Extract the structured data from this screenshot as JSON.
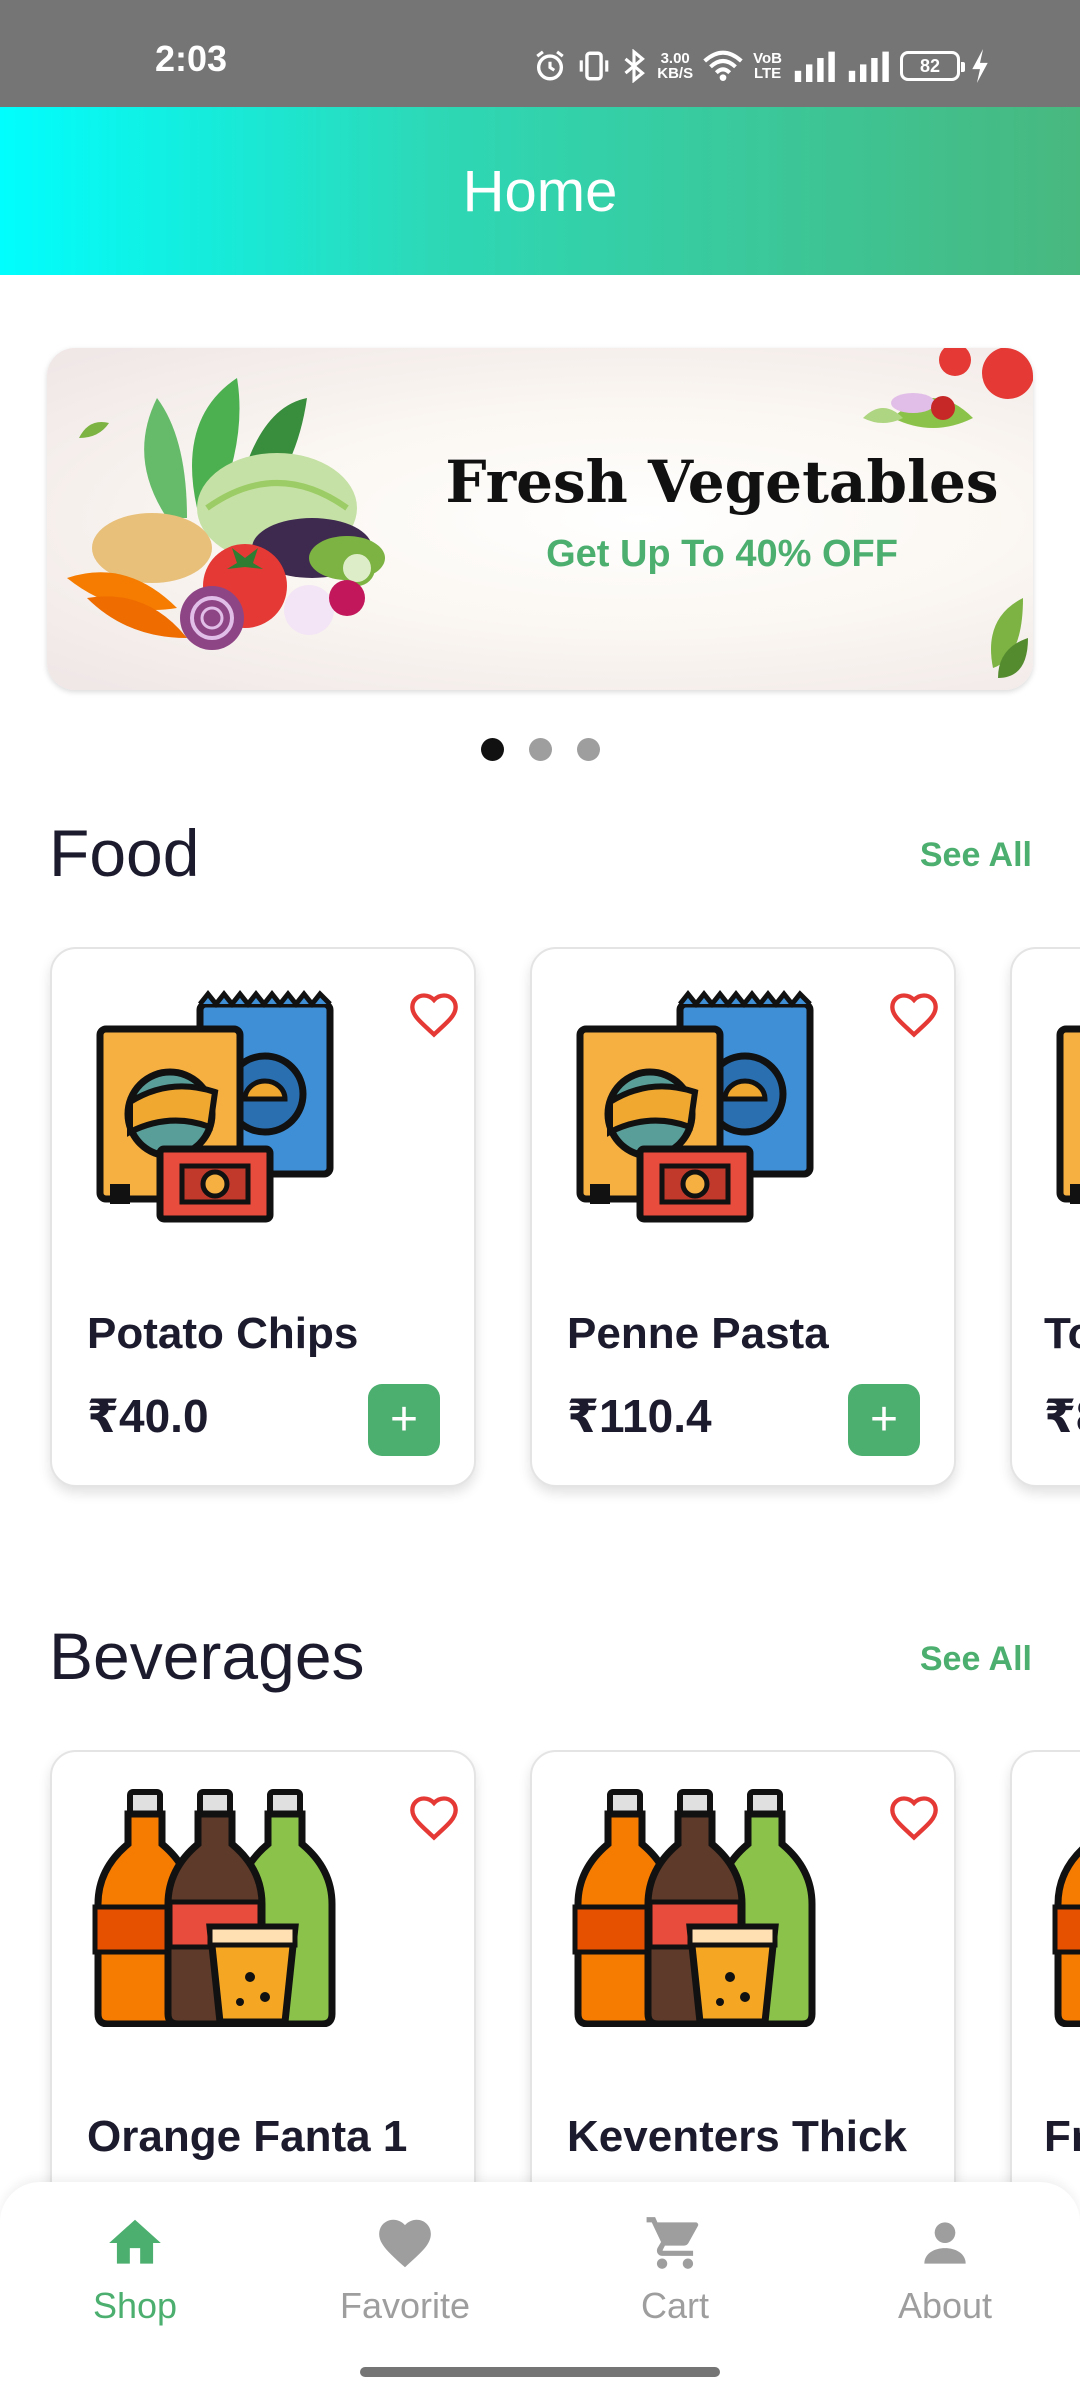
{
  "status_bar": {
    "time": "2:03",
    "network_speed_value": "3.00",
    "network_speed_unit": "KB/S",
    "volte_top": "VoB",
    "volte_bottom": "LTE",
    "battery": "82",
    "icons": [
      "alarm-icon",
      "vibrate-icon",
      "bluetooth-icon",
      "wifi-icon",
      "signal-icon",
      "signal-icon",
      "charging-icon"
    ]
  },
  "header": {
    "title": "Home"
  },
  "banner": {
    "title": "Fresh Vegetables",
    "subtitle": "Get Up To 40% OFF",
    "page_count": 3,
    "active_page": 1
  },
  "sections": [
    {
      "title": "Food",
      "see_all": "See All",
      "items": [
        {
          "name": "Potato Chips",
          "price": "₹40.0",
          "icon": "chips-icon"
        },
        {
          "name": "Penne Pasta",
          "price": "₹110.4",
          "icon": "chips-icon"
        },
        {
          "name": "To",
          "price": "₹8",
          "icon": "chips-icon"
        }
      ]
    },
    {
      "title": "Beverages",
      "see_all": "See All",
      "items": [
        {
          "name": "Orange Fanta 1",
          "icon": "bottles-icon"
        },
        {
          "name": "Keventers Thick",
          "icon": "bottles-icon"
        },
        {
          "name": "Fr",
          "icon": "bottles-icon"
        }
      ]
    }
  ],
  "bottom_nav": {
    "items": [
      {
        "label": "Shop",
        "icon": "home-icon",
        "active": true
      },
      {
        "label": "Favorite",
        "icon": "heart-icon",
        "active": false
      },
      {
        "label": "Cart",
        "icon": "cart-icon",
        "active": false
      },
      {
        "label": "About",
        "icon": "person-icon",
        "active": false
      }
    ]
  },
  "colors": {
    "accent": "#4caf6f",
    "favorite": "#e53935",
    "header_gradient_start": "#00fefe",
    "header_gradient_end": "#48b87f",
    "status_bar": "#757575"
  }
}
